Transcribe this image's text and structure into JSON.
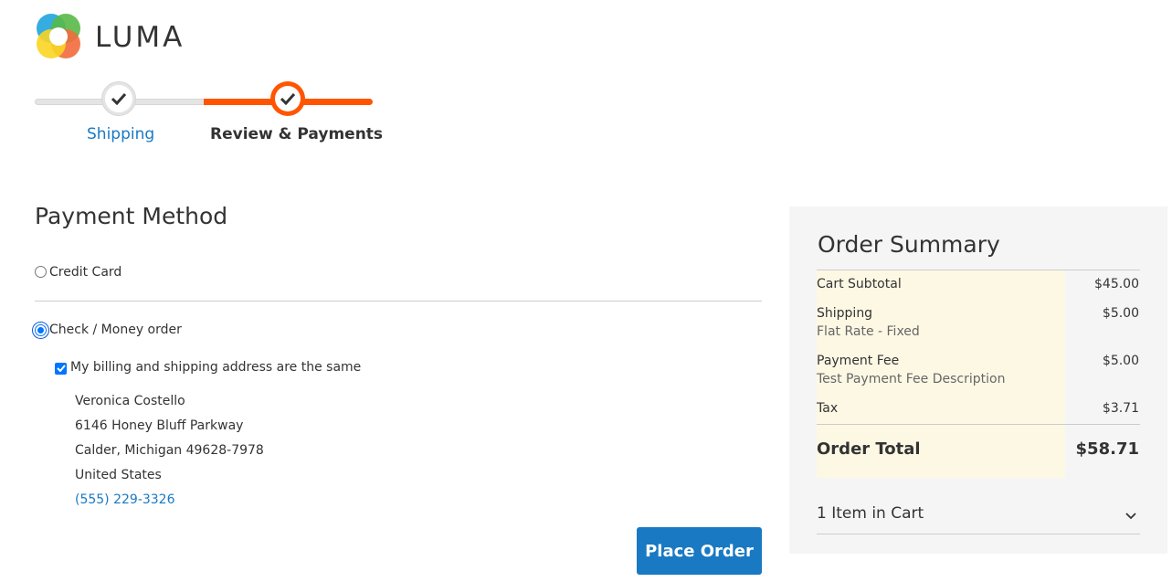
{
  "brand": {
    "name": "LUMA"
  },
  "progress": {
    "steps": [
      {
        "label": "Shipping",
        "state": "complete"
      },
      {
        "label": "Review & Payments",
        "state": "active"
      }
    ]
  },
  "payment": {
    "title": "Payment Method",
    "methods": [
      {
        "label": "Credit Card",
        "selected": false
      },
      {
        "label": "Check / Money order",
        "selected": true
      }
    ],
    "billing_same_label": "My billing and shipping address are the same",
    "billing_same_checked": true,
    "address": {
      "name": "Veronica Costello",
      "street": "6146 Honey Bluff Parkway",
      "city_line": "Calder, Michigan 49628-7978",
      "country": "United States",
      "phone": "(555) 229-3326"
    },
    "place_order_label": "Place Order"
  },
  "summary": {
    "title": "Order Summary",
    "rows": [
      {
        "label": "Cart Subtotal",
        "sub": "",
        "value": "$45.00"
      },
      {
        "label": "Shipping",
        "sub": "Flat Rate - Fixed",
        "value": "$5.00"
      },
      {
        "label": "Payment Fee",
        "sub": "Test Payment Fee Description",
        "value": "$5.00"
      },
      {
        "label": "Tax",
        "sub": "",
        "value": "$3.71"
      }
    ],
    "total_label": "Order Total",
    "total_value": "$58.71",
    "items_in_cart": "1 Item in Cart"
  },
  "colors": {
    "accent_orange": "#ff5501",
    "link_blue": "#1979c3",
    "highlight": "#fdf8e4"
  }
}
